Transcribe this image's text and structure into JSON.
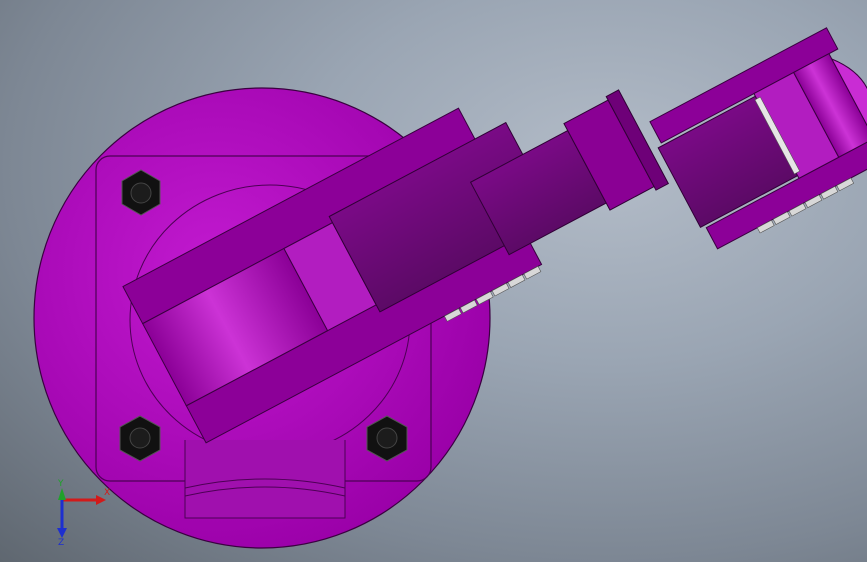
{
  "viewport": {
    "model_color": "#b000b8",
    "background_top": "#b3bcc8",
    "background_bottom": "#5f6770"
  },
  "triad": {
    "x_label": "X",
    "y_label": "Y",
    "z_label": "Z",
    "x_color": "#d21a1a",
    "y_color": "#1fa12a",
    "z_color": "#1d2fcf"
  }
}
